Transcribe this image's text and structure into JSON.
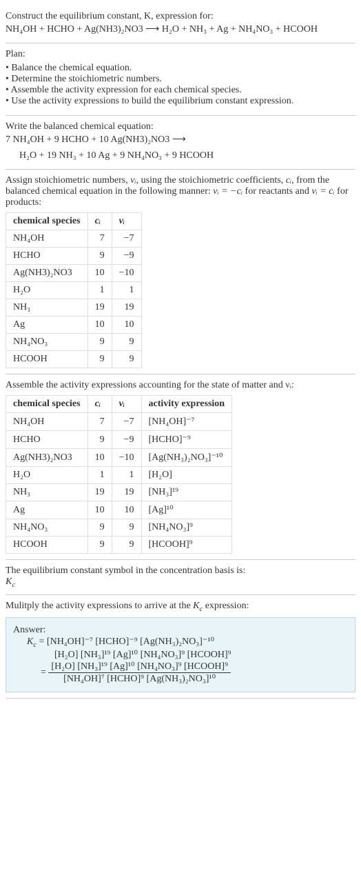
{
  "section1": {
    "intro": "Construct the equilibrium constant, K, expression for:",
    "equation_left": "NH₄OH + HCHO + Ag(NH3)₂NO3",
    "arrow": " ⟶ ",
    "equation_right": "H₂O + NH₃ + Ag + NH₄NO₃ + HCOOH"
  },
  "section2": {
    "title": "Plan:",
    "items": [
      "Balance the chemical equation.",
      "Determine the stoichiometric numbers.",
      "Assemble the activity expression for each chemical species.",
      "Use the activity expressions to build the equilibrium constant expression."
    ]
  },
  "section3": {
    "intro": "Write the balanced chemical equation:",
    "eq_line1": "7 NH₄OH + 9 HCHO + 10 Ag(NH3)₂NO3 ⟶",
    "eq_line2": "H₂O + 19 NH₃ + 10 Ag + 9 NH₄NO₃ + 9 HCOOH"
  },
  "section4": {
    "intro_part1": "Assign stoichiometric numbers, ",
    "vi": "νᵢ",
    "intro_part2": ", using the stoichiometric coefficients, ",
    "ci": "cᵢ",
    "intro_part3": ", from the balanced chemical equation in the following manner: ",
    "rule1": "νᵢ = −cᵢ",
    "intro_part4": " for reactants and ",
    "rule2": "νᵢ = cᵢ",
    "intro_part5": " for products:",
    "headers": [
      "chemical species",
      "cᵢ",
      "νᵢ"
    ],
    "rows": [
      {
        "species": "NH₄OH",
        "c": "7",
        "v": "−7"
      },
      {
        "species": "HCHO",
        "c": "9",
        "v": "−9"
      },
      {
        "species": "Ag(NH3)₂NO3",
        "c": "10",
        "v": "−10"
      },
      {
        "species": "H₂O",
        "c": "1",
        "v": "1"
      },
      {
        "species": "NH₃",
        "c": "19",
        "v": "19"
      },
      {
        "species": "Ag",
        "c": "10",
        "v": "10"
      },
      {
        "species": "NH₄NO₃",
        "c": "9",
        "v": "9"
      },
      {
        "species": "HCOOH",
        "c": "9",
        "v": "9"
      }
    ]
  },
  "section5": {
    "intro": "Assemble the activity expressions accounting for the state of matter and νᵢ:",
    "headers": [
      "chemical species",
      "cᵢ",
      "νᵢ",
      "activity expression"
    ],
    "rows": [
      {
        "species": "NH₄OH",
        "c": "7",
        "v": "−7",
        "act": "[NH₄OH]⁻⁷"
      },
      {
        "species": "HCHO",
        "c": "9",
        "v": "−9",
        "act": "[HCHO]⁻⁹"
      },
      {
        "species": "Ag(NH3)₂NO3",
        "c": "10",
        "v": "−10",
        "act": "[Ag(NH₃)₂NO₃]⁻¹⁰"
      },
      {
        "species": "H₂O",
        "c": "1",
        "v": "1",
        "act": "[H₂O]"
      },
      {
        "species": "NH₃",
        "c": "19",
        "v": "19",
        "act": "[NH₃]¹⁹"
      },
      {
        "species": "Ag",
        "c": "10",
        "v": "10",
        "act": "[Ag]¹⁰"
      },
      {
        "species": "NH₄NO₃",
        "c": "9",
        "v": "9",
        "act": "[NH₄NO₃]⁹"
      },
      {
        "species": "HCOOH",
        "c": "9",
        "v": "9",
        "act": "[HCOOH]⁹"
      }
    ]
  },
  "section6": {
    "line1": "The equilibrium constant symbol in the concentration basis is:",
    "symbol": "K_c"
  },
  "section7": {
    "intro": "Mulitply the activity expressions to arrive at the K_c expression:",
    "answer_label": "Answer:",
    "kc": "K_c =",
    "line1": "[NH₄OH]⁻⁷ [HCHO]⁻⁹ [Ag(NH₃)₂NO₃]⁻¹⁰",
    "line2": "[H₂O] [NH₃]¹⁹ [Ag]¹⁰ [NH₄NO₃]⁹ [HCOOH]⁹",
    "eq": "=",
    "frac_num": "[H₂O] [NH₃]¹⁹ [Ag]¹⁰ [NH₄NO₃]⁹ [HCOOH]⁹",
    "frac_den": "[NH₄OH]⁷ [HCHO]⁹ [Ag(NH₃)₂NO₃]¹⁰"
  },
  "chart_data": {
    "type": "table",
    "tables": [
      {
        "title": "Stoichiometric numbers",
        "headers": [
          "chemical species",
          "c_i",
          "ν_i"
        ],
        "rows": [
          [
            "NH4OH",
            7,
            -7
          ],
          [
            "HCHO",
            9,
            -9
          ],
          [
            "Ag(NH3)2NO3",
            10,
            -10
          ],
          [
            "H2O",
            1,
            1
          ],
          [
            "NH3",
            19,
            19
          ],
          [
            "Ag",
            10,
            10
          ],
          [
            "NH4NO3",
            9,
            9
          ],
          [
            "HCOOH",
            9,
            9
          ]
        ]
      },
      {
        "title": "Activity expressions",
        "headers": [
          "chemical species",
          "c_i",
          "ν_i",
          "activity expression"
        ],
        "rows": [
          [
            "NH4OH",
            7,
            -7,
            "[NH4OH]^-7"
          ],
          [
            "HCHO",
            9,
            -9,
            "[HCHO]^-9"
          ],
          [
            "Ag(NH3)2NO3",
            10,
            -10,
            "[Ag(NH3)2NO3]^-10"
          ],
          [
            "H2O",
            1,
            1,
            "[H2O]"
          ],
          [
            "NH3",
            19,
            19,
            "[NH3]^19"
          ],
          [
            "Ag",
            10,
            10,
            "[Ag]^10"
          ],
          [
            "NH4NO3",
            9,
            9,
            "[NH4NO3]^9"
          ],
          [
            "HCOOH",
            9,
            9,
            "[HCOOH]^9"
          ]
        ]
      }
    ]
  }
}
